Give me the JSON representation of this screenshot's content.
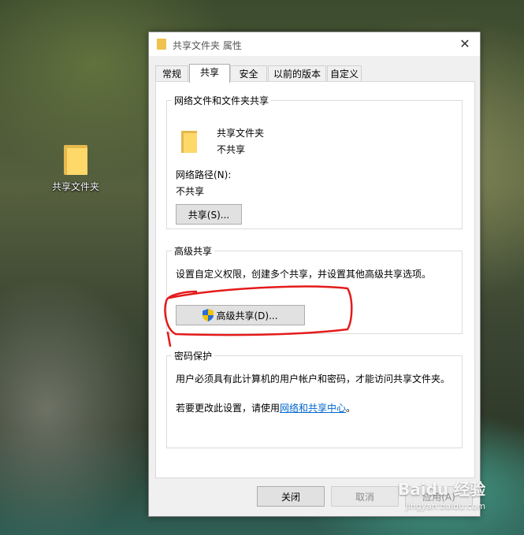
{
  "desktop": {
    "icon_label": "共享文件夹"
  },
  "dialog": {
    "title": "共享文件夹 属性",
    "tabs": [
      "常规",
      "共享",
      "安全",
      "以前的版本",
      "自定义"
    ],
    "network_section": {
      "legend": "网络文件和文件夹共享",
      "folder_name": "共享文件夹",
      "folder_status": "不共享",
      "path_label": "网络路径(N):",
      "path_value": "不共享",
      "share_button": "共享(S)..."
    },
    "advanced_section": {
      "legend": "高级共享",
      "description": "设置自定义权限，创建多个共享，并设置其他高级共享选项。",
      "button": "高级共享(D)..."
    },
    "password_section": {
      "legend": "密码保护",
      "description": "用户必须具有此计算机的用户帐户和密码，才能访问共享文件夹。",
      "change_prefix": "若要更改此设置，请使用",
      "link_text": "网络和共享中心",
      "change_suffix": "。"
    },
    "buttons": {
      "close": "关闭",
      "cancel": "取消",
      "apply": "应用(A)"
    }
  },
  "watermark": {
    "brand": "Baidu 经验",
    "url": "jingyan.baidu.com"
  },
  "colors": {
    "annotation": "#e41b1b",
    "link": "#0066cc",
    "folder": "#ffd86a"
  }
}
